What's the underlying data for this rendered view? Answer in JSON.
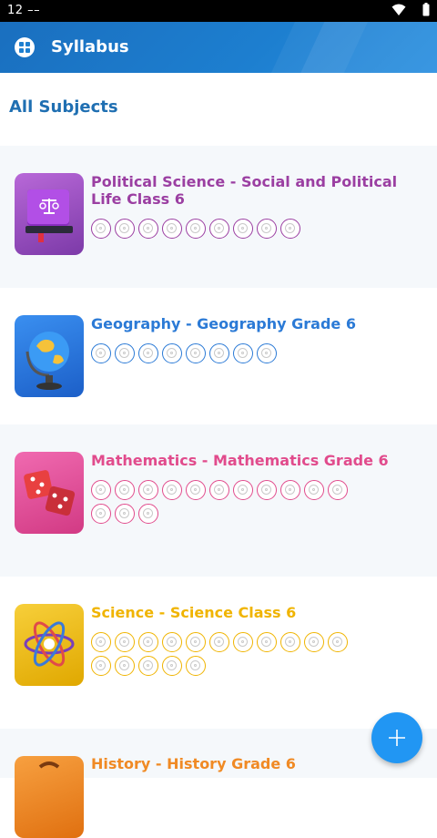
{
  "status_bar": {
    "time": "12 ––"
  },
  "app_bar": {
    "title": "Syllabus",
    "accent": "#1d7fd0"
  },
  "section": {
    "title": "All Subjects"
  },
  "subjects": [
    {
      "title": "Political Science - Social and Political Life Class 6",
      "color": "#9b3fa2",
      "rings": 9,
      "icon": "law-book-icon"
    },
    {
      "title": "Geography - Geography Grade 6",
      "color": "#2b7ad6",
      "rings": 8,
      "icon": "globe-icon"
    },
    {
      "title": "Mathematics - Mathematics Grade 6",
      "color": "#e14b8c",
      "rings": 14,
      "icon": "dice-icon"
    },
    {
      "title": "Science - Science Class 6",
      "color": "#f0b400",
      "rings": 16,
      "icon": "atom-icon"
    },
    {
      "title": "History - History Grade 6",
      "color": "#f08a24",
      "rings": 0,
      "icon": "history-icon"
    }
  ],
  "fab": {
    "icon": "plus-icon",
    "color": "#2196f3"
  }
}
